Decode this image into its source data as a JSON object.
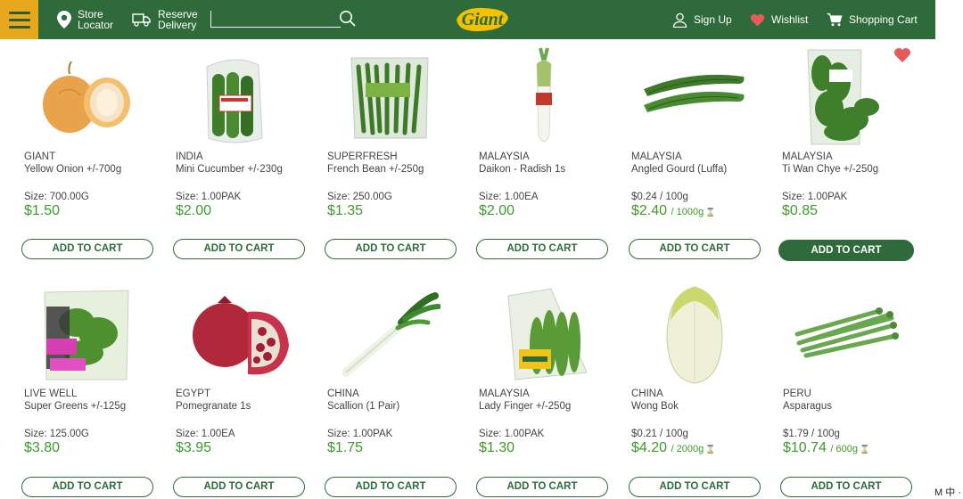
{
  "header": {
    "store_label": "Store Locator",
    "store_line1": "Store",
    "store_line2": "Locator",
    "reserve_line1": "Reserve",
    "reserve_line2": "Delivery",
    "search_placeholder": "",
    "logo_text": "Giant",
    "signin_label": "Sign Up",
    "wishlist_label": "Wishlist",
    "cart_label": "Shopping Cart"
  },
  "colors": {
    "brand_green": "#2f6b3a",
    "accent_yellow": "#e8a81e",
    "price_green": "#3d9a2a",
    "heart_red": "#e8595a"
  },
  "products": [
    {
      "origin": "GIANT",
      "name": "Yellow Onion +/-700g",
      "size": "Size: 700.00G",
      "price": "$1.50",
      "cart_label": "ADD TO CART",
      "image": "onion"
    },
    {
      "origin": "INDIA",
      "name": "Mini Cucumber +/-230g",
      "size": "Size: 1.00PAK",
      "price": "$2.00",
      "cart_label": "ADD TO CART",
      "image": "cucumber-pack"
    },
    {
      "origin": "SUPERFRESH",
      "name": "French Bean +/-250g",
      "size": "Size: 250.00G",
      "price": "$1.35",
      "cart_label": "ADD TO CART",
      "image": "french-bean-pack"
    },
    {
      "origin": "MALAYSIA",
      "name": "Daikon - Radish 1s",
      "size": "Size: 1.00EA",
      "price": "$2.00",
      "cart_label": "ADD TO CART",
      "image": "daikon"
    },
    {
      "origin": "MALAYSIA",
      "name": "Angled Gourd (Luffa)",
      "size": "$0.24 / 100g",
      "price": "$2.40",
      "price_unit": "/ 1000g",
      "cart_label": "ADD TO CART",
      "image": "luffa"
    },
    {
      "origin": "MALAYSIA",
      "name": "Ti Wan Chye +/-250g",
      "size": "Size: 1.00PAK",
      "price": "$0.85",
      "cart_label": "ADD TO CART",
      "image": "ti-wan-chye",
      "cart_active": true
    },
    {
      "origin": "LIVE WELL",
      "name": "Super Greens +/-125g",
      "size": "Size: 125.00G",
      "price": "$3.80",
      "cart_label": "ADD TO CART",
      "image": "salad-bag"
    },
    {
      "origin": "EGYPT",
      "name": "Pomegranate 1s",
      "size": "Size: 1.00EA",
      "price": "$3.95",
      "cart_label": "ADD TO CART",
      "image": "pomegranate"
    },
    {
      "origin": "CHINA",
      "name": "Scallion (1 Pair)",
      "size": "Size: 1.00PAK",
      "price": "$1.75",
      "cart_label": "ADD TO CART",
      "image": "scallion"
    },
    {
      "origin": "MALAYSIA",
      "name": "Lady Finger +/-250g",
      "size": "Size: 1.00PAK",
      "price": "$1.30",
      "cart_label": "ADD TO CART",
      "image": "lady-finger-pack"
    },
    {
      "origin": "CHINA",
      "name": "Wong Bok",
      "size": "$0.21 / 100g",
      "price": "$4.20",
      "price_unit": "/ 2000g",
      "cart_label": "ADD TO CART",
      "image": "wong-bok"
    },
    {
      "origin": "PERU",
      "name": "Asparagus",
      "size": "$1.79 / 100g",
      "price": "$10.74",
      "price_unit": "/ 600g",
      "cart_label": "ADD TO CART",
      "image": "asparagus"
    }
  ],
  "ime_text": "M 中 ·"
}
